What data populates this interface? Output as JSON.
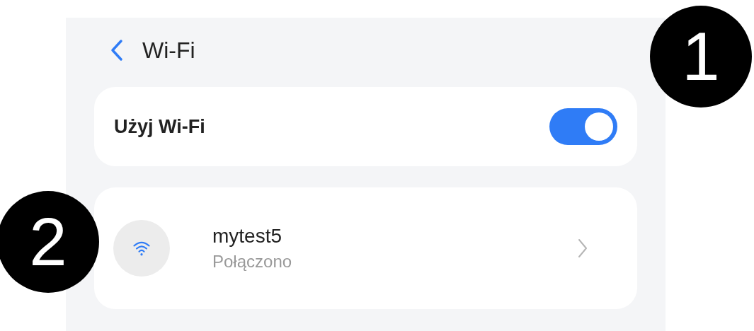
{
  "header": {
    "title": "Wi-Fi"
  },
  "wifi_toggle": {
    "label": "Użyj Wi-Fi",
    "on": true
  },
  "network": {
    "name": "mytest5",
    "status": "Połączono"
  },
  "annotations": [
    {
      "label": "1"
    },
    {
      "label": "2"
    }
  ]
}
